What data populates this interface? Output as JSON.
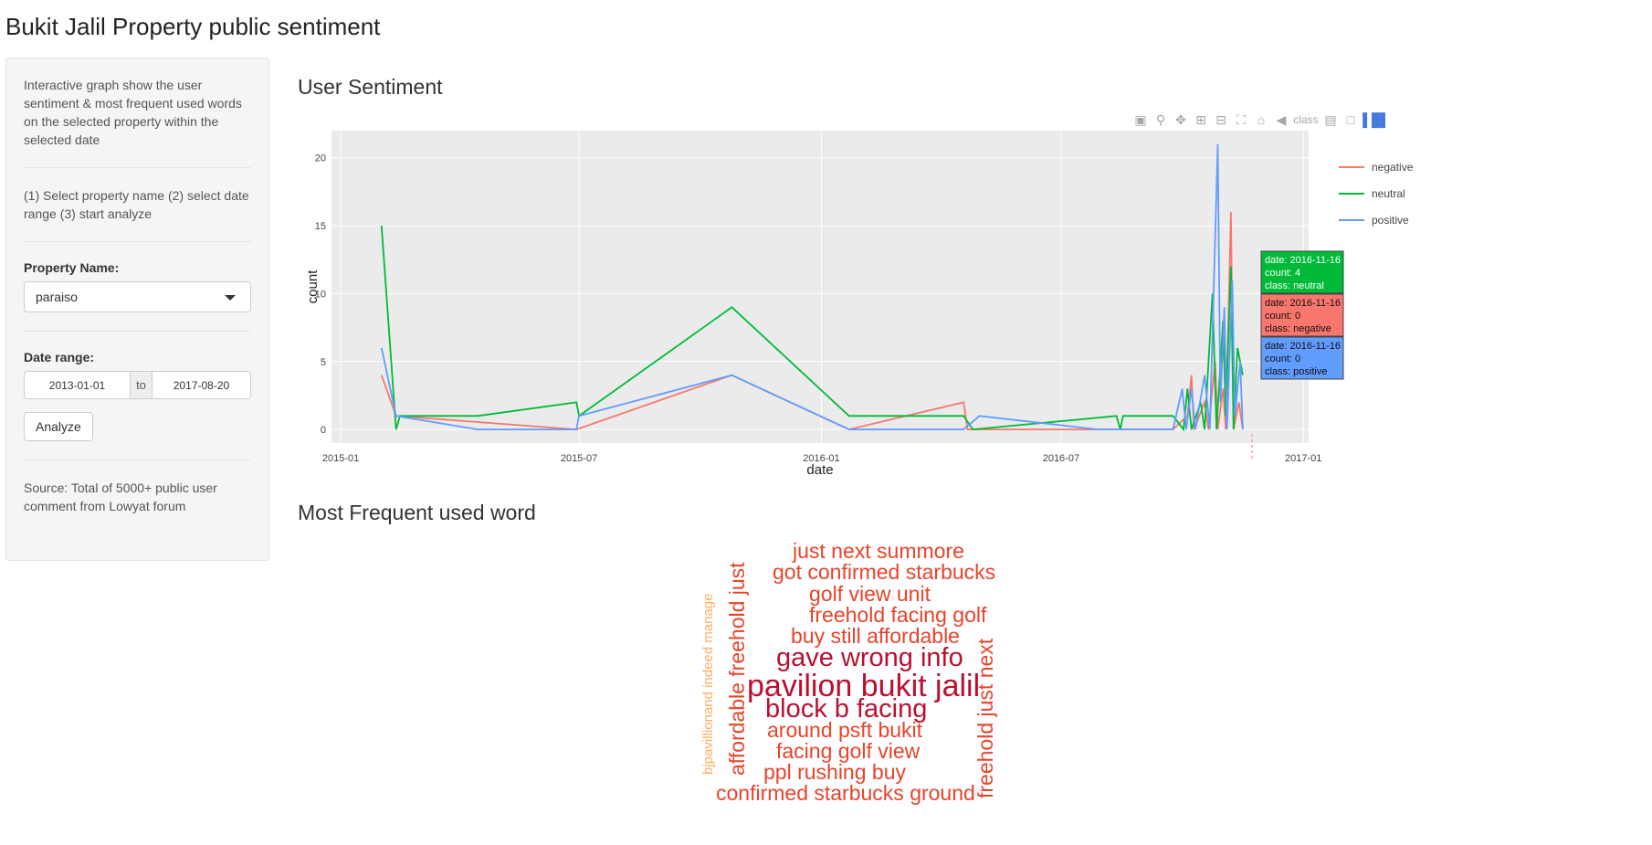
{
  "app_title": "Bukit Jalil Property public sentiment",
  "sidebar": {
    "description": "Interactive graph show the user sentiment & most frequent used words on the selected property within the selected date",
    "steps": "(1) Select property name (2) select date range (3) start analyze",
    "property_label": "Property Name:",
    "property_value": "paraiso",
    "date_label": "Date range:",
    "date_start": "2013-01-01",
    "date_sep": "to",
    "date_end": "2017-08-20",
    "analyze_label": "Analyze",
    "source": "Source: Total of 5000+ public user comment from Lowyat forum"
  },
  "sentiment_title": "User Sentiment",
  "wordcloud_title": "Most Frequent used word",
  "chart_data": {
    "type": "line",
    "xlabel": "date",
    "ylabel": "count",
    "x_ticks": [
      "2015-01",
      "2015-07",
      "2016-01",
      "2016-07",
      "2017-01"
    ],
    "y_ticks": [
      "0",
      "5",
      "10",
      "15",
      "20"
    ],
    "xlim": [
      "2014-12-25",
      "2017-01-05"
    ],
    "ylim": [
      -1,
      22
    ],
    "grid": true,
    "legend_position": "right",
    "series": [
      {
        "name": "negative",
        "color": "#f8766d",
        "points": [
          [
            "2015-02-01",
            4
          ],
          [
            "2015-02-12",
            1
          ],
          [
            "2015-06-29",
            0
          ],
          [
            "2015-10-25",
            4
          ],
          [
            "2016-01-22",
            0
          ],
          [
            "2016-04-18",
            2
          ],
          [
            "2016-04-21",
            0
          ],
          [
            "2016-07-29",
            0
          ],
          [
            "2016-09-24",
            0
          ],
          [
            "2016-10-05",
            1
          ],
          [
            "2016-10-08",
            4
          ],
          [
            "2016-10-10",
            0
          ],
          [
            "2016-10-18",
            2
          ],
          [
            "2016-10-21",
            0
          ],
          [
            "2016-10-26",
            5
          ],
          [
            "2016-10-28",
            0
          ],
          [
            "2016-11-01",
            3
          ],
          [
            "2016-11-03",
            0
          ],
          [
            "2016-11-07",
            16
          ],
          [
            "2016-11-09",
            0
          ],
          [
            "2016-11-13",
            2
          ],
          [
            "2016-11-16",
            0
          ]
        ]
      },
      {
        "name": "neutral",
        "color": "#00ba38",
        "points": [
          [
            "2015-02-01",
            15
          ],
          [
            "2015-02-12",
            0
          ],
          [
            "2015-02-15",
            1
          ],
          [
            "2015-04-15",
            1
          ],
          [
            "2015-06-29",
            2
          ],
          [
            "2015-07-01",
            1
          ],
          [
            "2015-10-25",
            9
          ],
          [
            "2016-01-22",
            1
          ],
          [
            "2016-04-18",
            1
          ],
          [
            "2016-04-25",
            0
          ],
          [
            "2016-08-12",
            1
          ],
          [
            "2016-08-15",
            0
          ],
          [
            "2016-08-17",
            1
          ],
          [
            "2016-09-24",
            1
          ],
          [
            "2016-10-02",
            0
          ],
          [
            "2016-10-05",
            3
          ],
          [
            "2016-10-08",
            0
          ],
          [
            "2016-10-15",
            2
          ],
          [
            "2016-10-18",
            0
          ],
          [
            "2016-10-24",
            10
          ],
          [
            "2016-10-27",
            0
          ],
          [
            "2016-11-01",
            8
          ],
          [
            "2016-11-03",
            1
          ],
          [
            "2016-11-07",
            12
          ],
          [
            "2016-11-09",
            0
          ],
          [
            "2016-11-12",
            6
          ],
          [
            "2016-11-16",
            4
          ]
        ]
      },
      {
        "name": "positive",
        "color": "#619cff",
        "points": [
          [
            "2015-02-01",
            6
          ],
          [
            "2015-02-12",
            1
          ],
          [
            "2015-04-15",
            0
          ],
          [
            "2015-06-29",
            0
          ],
          [
            "2015-07-01",
            1
          ],
          [
            "2015-10-25",
            4
          ],
          [
            "2016-01-22",
            0
          ],
          [
            "2016-04-18",
            0
          ],
          [
            "2016-04-30",
            1
          ],
          [
            "2016-07-29",
            0
          ],
          [
            "2016-08-12",
            0
          ],
          [
            "2016-09-24",
            0
          ],
          [
            "2016-10-01",
            3
          ],
          [
            "2016-10-04",
            0
          ],
          [
            "2016-10-08",
            3
          ],
          [
            "2016-10-11",
            0
          ],
          [
            "2016-10-18",
            4
          ],
          [
            "2016-10-22",
            0
          ],
          [
            "2016-10-28",
            21
          ],
          [
            "2016-10-30",
            2
          ],
          [
            "2016-11-02",
            9
          ],
          [
            "2016-11-04",
            0
          ],
          [
            "2016-11-08",
            11
          ],
          [
            "2016-11-10",
            1
          ],
          [
            "2016-11-14",
            5
          ],
          [
            "2016-11-16",
            0
          ]
        ]
      }
    ],
    "hover_labels": [
      {
        "series": "neutral",
        "lines": [
          "date: 2016-11-16",
          "count: 4",
          "class: neutral"
        ]
      },
      {
        "series": "negative",
        "lines": [
          "date: 2016-11-16",
          "count: 0",
          "class: negative"
        ]
      },
      {
        "series": "positive",
        "lines": [
          "date: 2016-11-16",
          "count: 0",
          "class: positive"
        ]
      }
    ]
  },
  "modebar": {
    "icons": [
      "camera-icon",
      "zoom-icon",
      "pan-icon",
      "zoom-in-icon",
      "zoom-out-icon",
      "autoscale-icon",
      "reset-axes-icon",
      "hover-closest-icon",
      "hover-compare-icon",
      "spikelines-icon",
      "plotly-logo-icon"
    ],
    "overlapped_text": "class"
  },
  "wordcloud": {
    "words": [
      {
        "text": "just next summore",
        "size": 23,
        "color": "#e8432a"
      },
      {
        "text": "got confirmed starbucks",
        "size": 23,
        "color": "#e8432a"
      },
      {
        "text": "golf view unit",
        "size": 23,
        "color": "#e8432a"
      },
      {
        "text": "freehold facing golf",
        "size": 23,
        "color": "#e8432a"
      },
      {
        "text": "buy still affordable",
        "size": 23,
        "color": "#e8432a"
      },
      {
        "text": "gave wrong info",
        "size": 29,
        "color": "#bb1030"
      },
      {
        "text": "pavilion bukit jalil",
        "size": 34,
        "color": "#bb1030"
      },
      {
        "text": "block b facing",
        "size": 29,
        "color": "#bb1030"
      },
      {
        "text": "around psft bukit",
        "size": 23,
        "color": "#e8432a"
      },
      {
        "text": "facing golf view",
        "size": 23,
        "color": "#e8432a"
      },
      {
        "text": "ppl rushing buy",
        "size": 23,
        "color": "#e8432a"
      },
      {
        "text": "confirmed starbucks ground",
        "size": 23,
        "color": "#e8432a"
      },
      {
        "text": "affordable freehold just",
        "size": 23,
        "color": "#e8432a"
      },
      {
        "text": "bjpavillionand indeed manage",
        "size": 15,
        "color": "#fdae61"
      },
      {
        "text": "freehold just next",
        "size": 23,
        "color": "#e8432a"
      }
    ]
  }
}
